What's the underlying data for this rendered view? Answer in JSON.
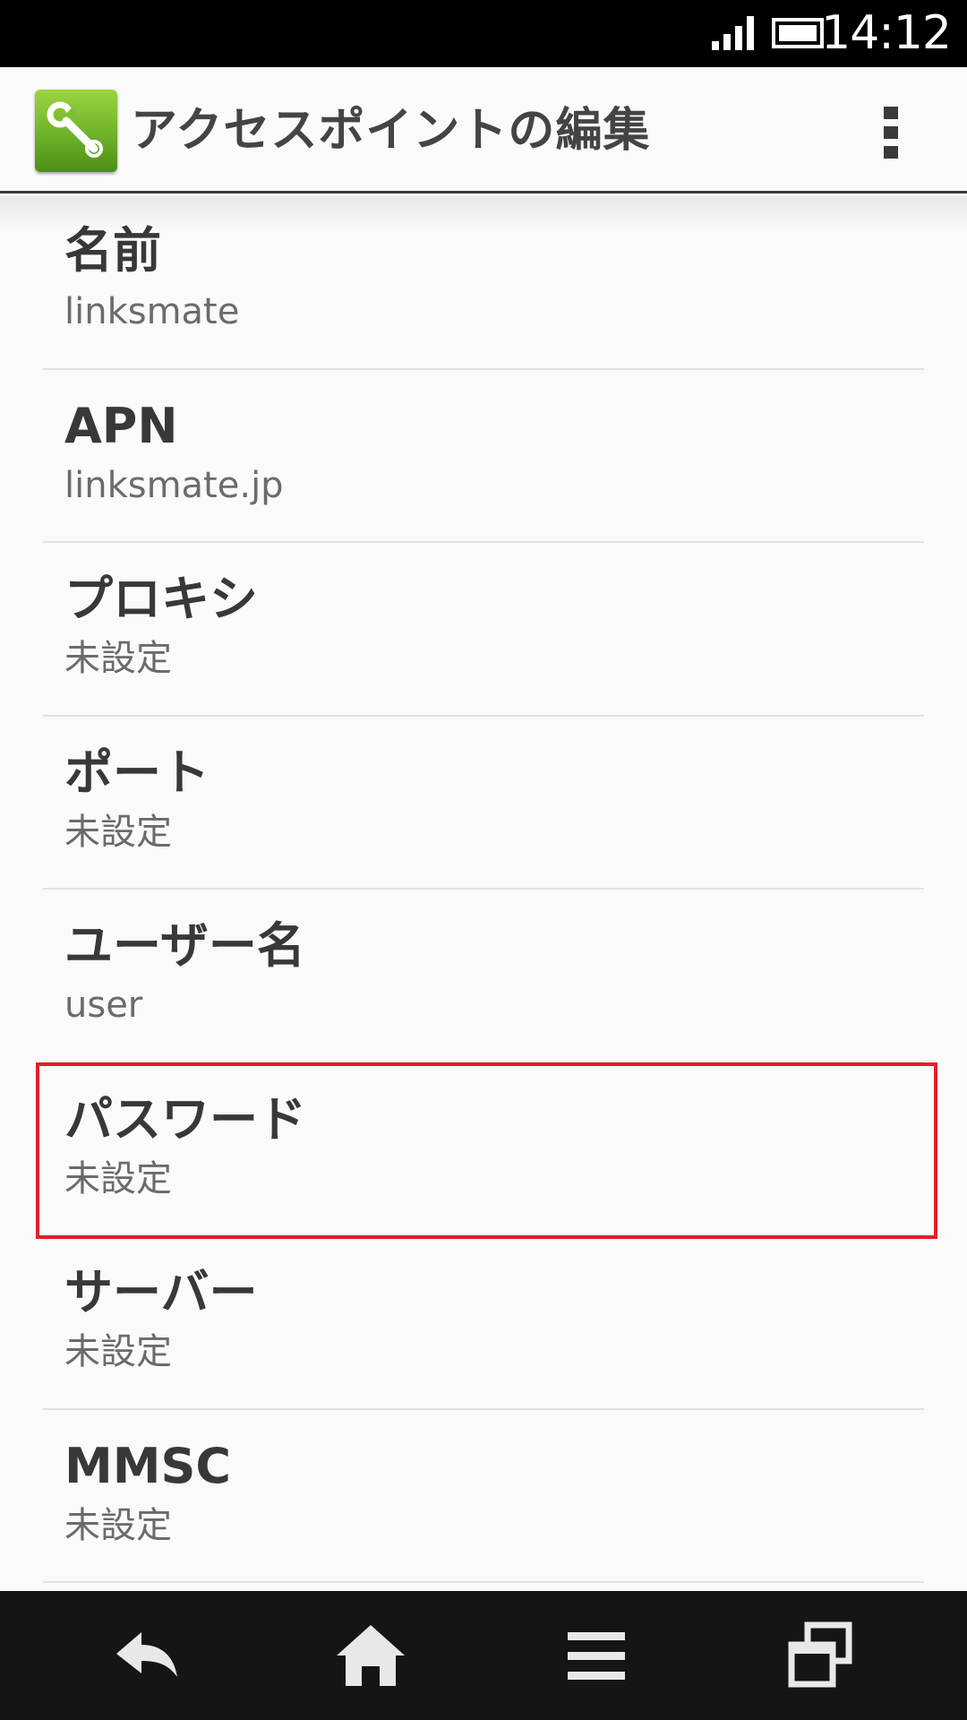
{
  "status_bar": {
    "time": "14:12",
    "signal_icon": "signal-strength-icon",
    "battery_icon": "battery-icon"
  },
  "action_bar": {
    "app_icon": "wrench-settings-icon",
    "title": "アクセスポイントの編集",
    "overflow_icon": "overflow-menu-icon"
  },
  "settings": [
    {
      "label": "名前",
      "value": "linksmate"
    },
    {
      "label": "APN",
      "value": "linksmate.jp"
    },
    {
      "label": "プロキシ",
      "value": "未設定"
    },
    {
      "label": "ポート",
      "value": "未設定"
    },
    {
      "label": "ユーザー名",
      "value": "user"
    },
    {
      "label": "パスワード",
      "value": "未設定"
    },
    {
      "label": "サーバー",
      "value": "未設定"
    },
    {
      "label": "MMSC",
      "value": "未設定"
    }
  ],
  "nav_bar": {
    "back_icon": "back-icon",
    "home_icon": "home-icon",
    "menu_icon": "menu-icon",
    "recents_icon": "recent-apps-icon"
  },
  "colors": {
    "highlight": "#e0202a",
    "app_icon_green": "#6fb22a"
  }
}
